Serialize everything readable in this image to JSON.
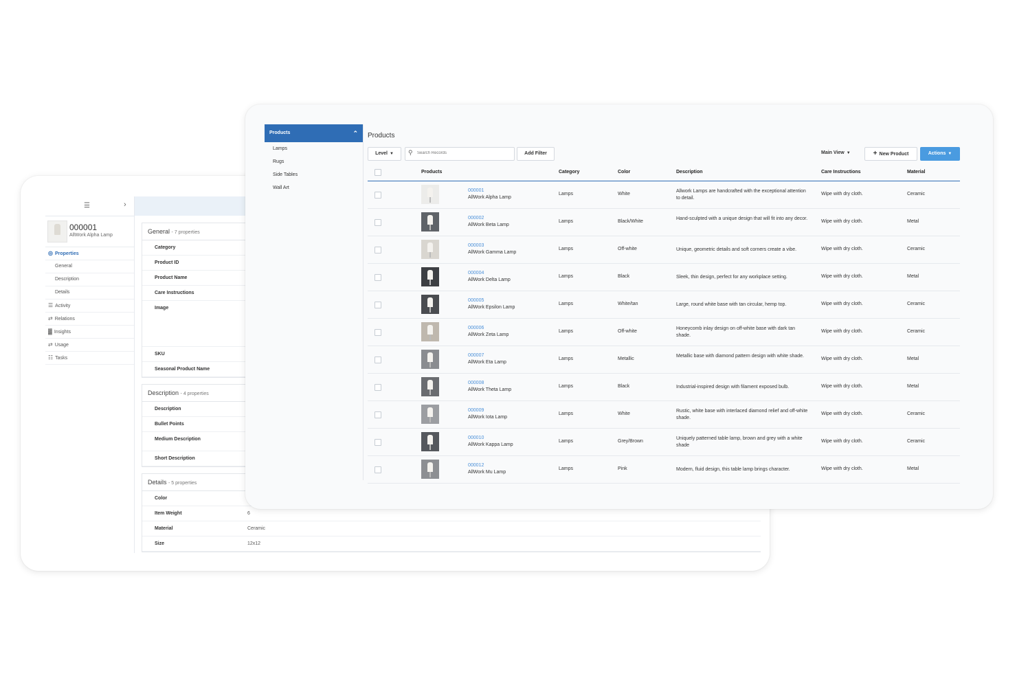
{
  "detail": {
    "record_id": "000001",
    "record_name": "AllWork Alpha Lamp",
    "nav": [
      {
        "label": "Properties",
        "icon": "properties-icon",
        "active": true,
        "level": "top"
      },
      {
        "label": "General",
        "level": "sub"
      },
      {
        "label": "Description",
        "level": "sub"
      },
      {
        "label": "Details",
        "level": "sub"
      },
      {
        "label": "Activity",
        "icon": "activity-icon",
        "level": "top"
      },
      {
        "label": "Relations",
        "icon": "relations-icon",
        "level": "top"
      },
      {
        "label": "Insights",
        "icon": "insights-icon",
        "level": "top"
      },
      {
        "label": "Usage",
        "icon": "usage-icon",
        "level": "top"
      },
      {
        "label": "Tasks",
        "icon": "tasks-icon",
        "level": "top"
      }
    ],
    "sections": {
      "general": {
        "title": "General",
        "count": "- 7 properties",
        "props": [
          "Category",
          "Product ID",
          "Product Name",
          "Care Instructions",
          "Image",
          "SKU",
          "Seasonal Product Name"
        ]
      },
      "description": {
        "title": "Description",
        "count": "- 4 properties",
        "props": [
          "Description",
          "Bullet Points",
          "Medium Description",
          "Short Description"
        ]
      },
      "details": {
        "title": "Details",
        "count": "- 5 properties",
        "props": [
          {
            "label": "Color",
            "value": ""
          },
          {
            "label": "Item Weight",
            "value": "6"
          },
          {
            "label": "Material",
            "value": "Ceramic"
          },
          {
            "label": "Size",
            "value": "12x12"
          }
        ]
      }
    }
  },
  "categories": {
    "header": "Products",
    "items": [
      "Lamps",
      "Rugs",
      "Side Tables",
      "Wall Art"
    ]
  },
  "products": {
    "title": "Products",
    "toolbar": {
      "level_label": "Level",
      "search_placeholder": "Search Records",
      "add_filter_label": "Add Filter",
      "main_view_label": "Main View",
      "new_product_label": "New Product",
      "actions_label": "Actions"
    },
    "columns": [
      "Products",
      "Category",
      "Color",
      "Description",
      "Care Instructions",
      "Material"
    ],
    "rows": [
      {
        "id": "000001",
        "name": "AllWork Alpha Lamp",
        "category": "Lamps",
        "color": "White",
        "description": "Allwork Lamps are handcrafted with the exceptional attention to detail.",
        "care": "Wipe with dry cloth.",
        "material": "Ceramic",
        "thumb": "#ececea"
      },
      {
        "id": "000002",
        "name": "AllWork Beta Lamp",
        "category": "Lamps",
        "color": "Black/White",
        "description": "Hand-sculpted with a unique design that will fit into any decor.",
        "care": "Wipe with dry cloth.",
        "material": "Metal",
        "thumb": "#5f6368"
      },
      {
        "id": "000003",
        "name": "AllWork Gamma Lamp",
        "category": "Lamps",
        "color": "Off-white",
        "description": "Unique, geometric details and soft corners create a vibe.",
        "care": "Wipe with dry cloth.",
        "material": "Ceramic",
        "thumb": "#d9d6d0"
      },
      {
        "id": "000004",
        "name": "AllWork Delta Lamp",
        "category": "Lamps",
        "color": "Black",
        "description": "Sleek, thin design, perfect for any workplace setting.",
        "care": "Wipe with dry cloth.",
        "material": "Metal",
        "thumb": "#3d3f43"
      },
      {
        "id": "000005",
        "name": "AllWork Epsilon Lamp",
        "category": "Lamps",
        "color": "White/tan",
        "description": "Large, round white base with tan circular, hemp top.",
        "care": "Wipe with dry cloth.",
        "material": "Ceramic",
        "thumb": "#4a4c50"
      },
      {
        "id": "000006",
        "name": "AllWork Zeta Lamp",
        "category": "Lamps",
        "color": "Off-white",
        "description": "Honeycomb inlay design on off-white base with dark tan shade.",
        "care": "Wipe with dry cloth.",
        "material": "Ceramic",
        "thumb": "#bfb8ae"
      },
      {
        "id": "000007",
        "name": "AllWork Eta Lamp",
        "category": "Lamps",
        "color": "Metallic",
        "description": "Metallic base with diamond pattern design with white shade.",
        "care": "Wipe with dry cloth.",
        "material": "Metal",
        "thumb": "#8a8c90"
      },
      {
        "id": "000008",
        "name": "AllWork Theta Lamp",
        "category": "Lamps",
        "color": "Black",
        "description": "Industrial-inspired design with filament exposed bulb.",
        "care": "Wipe with dry cloth.",
        "material": "Metal",
        "thumb": "#6a6c70"
      },
      {
        "id": "000009",
        "name": "AllWork Iota Lamp",
        "category": "Lamps",
        "color": "White",
        "description": "Rustic, white base with interlaced diamond relief and off-white shade.",
        "care": "Wipe with dry cloth.",
        "material": "Ceramic",
        "thumb": "#9c9ea2"
      },
      {
        "id": "000010",
        "name": "AllWork Kappa Lamp",
        "category": "Lamps",
        "color": "Grey/Brown",
        "description": "Uniquely patterned table lamp, brown and grey with a white shade",
        "care": "Wipe with dry cloth.",
        "material": "Ceramic",
        "thumb": "#55585d"
      },
      {
        "id": "000012",
        "name": "AllWork Mu Lamp",
        "category": "Lamps",
        "color": "Pink",
        "description": "Modern, fluid design, this table lamp brings character.",
        "care": "Wipe with dry cloth.",
        "material": "Metal",
        "thumb": "#8d8f93"
      }
    ]
  },
  "colors": {
    "brand_blue": "#2f6db5",
    "link_blue": "#4a8fd8",
    "actions_blue": "#4a9be0"
  }
}
